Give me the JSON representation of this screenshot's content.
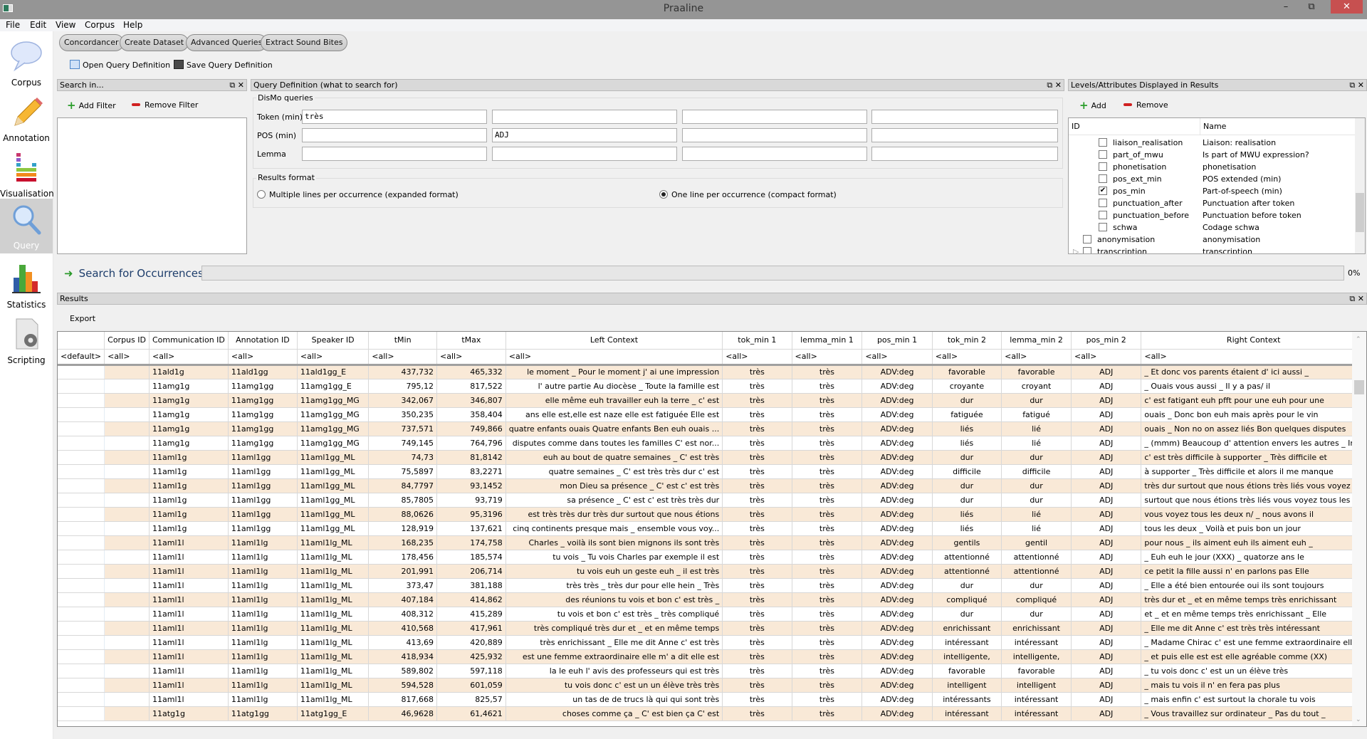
{
  "window": {
    "title": "Praaline"
  },
  "menu": [
    "File",
    "Edit",
    "View",
    "Corpus",
    "Help"
  ],
  "sidebar": {
    "items": [
      {
        "label": "Corpus",
        "icon": "speech-bubble-icon",
        "active": false
      },
      {
        "label": "Annotation",
        "icon": "pencil-icon",
        "active": false
      },
      {
        "label": "Visualisation",
        "icon": "equalizer-icon",
        "active": false
      },
      {
        "label": "Query",
        "icon": "magnifier-icon",
        "active": true
      },
      {
        "label": "Statistics",
        "icon": "bar-chart-icon",
        "active": false
      },
      {
        "label": "Scripting",
        "icon": "script-gear-icon",
        "active": false
      }
    ]
  },
  "modules": [
    "Concordancer",
    "Create Dataset",
    "Advanced Queries",
    "Extract Sound Bites"
  ],
  "toolbar": {
    "open_label": "Open Query Definition",
    "save_label": "Save Query Definition"
  },
  "search_in": {
    "title": "Search in...",
    "add_label": "Add Filter",
    "remove_label": "Remove Filter"
  },
  "query_def": {
    "title": "Query Definition (what to search for)",
    "group_label": "DisMo queries",
    "rows": [
      {
        "label": "Token (min)",
        "values": [
          "très",
          "",
          "",
          ""
        ]
      },
      {
        "label": "POS (min)",
        "values": [
          "",
          "ADJ",
          "",
          ""
        ]
      },
      {
        "label": "Lemma",
        "values": [
          "",
          "",
          "",
          ""
        ]
      }
    ],
    "results_format": {
      "label": "Results format",
      "options": [
        {
          "label": "Multiple lines per occurrence (expanded format)",
          "selected": false
        },
        {
          "label": "One line per occurrence (compact format)",
          "selected": true
        }
      ]
    }
  },
  "levels": {
    "title": "Levels/Attributes Displayed in Results",
    "add_label": "Add",
    "remove_label": "Remove",
    "columns": [
      "ID",
      "Name"
    ],
    "items": [
      {
        "id": "liaison_realisation",
        "name": "Liaison: realisation",
        "checked": false,
        "indent": 2
      },
      {
        "id": "part_of_mwu",
        "name": "Is part of MWU expression?",
        "checked": false,
        "indent": 2
      },
      {
        "id": "phonetisation",
        "name": "phonetisation",
        "checked": false,
        "indent": 2
      },
      {
        "id": "pos_ext_min",
        "name": "POS extended (min)",
        "checked": false,
        "indent": 2
      },
      {
        "id": "pos_min",
        "name": "Part-of-speech (min)",
        "checked": true,
        "indent": 2
      },
      {
        "id": "punctuation_after",
        "name": "Punctuation after token",
        "checked": false,
        "indent": 2
      },
      {
        "id": "punctuation_before",
        "name": "Punctuation before token",
        "checked": false,
        "indent": 2
      },
      {
        "id": "schwa",
        "name": "Codage schwa",
        "checked": false,
        "indent": 2
      },
      {
        "id": "anonymisation",
        "name": "anonymisation",
        "checked": false,
        "indent": 1
      },
      {
        "id": "transcription",
        "name": "transcription",
        "checked": false,
        "indent": 1,
        "expandable": true
      }
    ]
  },
  "search": {
    "button_label": "Search for Occurrences",
    "progress_percent": 0,
    "progress_label": "0%"
  },
  "results": {
    "title": "Results",
    "export_label": "Export",
    "columns": [
      "",
      "Corpus ID",
      "Communication ID",
      "Annotation ID",
      "Speaker ID",
      "tMin",
      "tMax",
      "Left Context",
      "tok_min 1",
      "lemma_min 1",
      "pos_min 1",
      "tok_min 2",
      "lemma_min 2",
      "pos_min 2",
      "Right Context"
    ],
    "filters": [
      "<default>",
      "<all>",
      "<all>",
      "<all>",
      "<all>",
      "<all>",
      "<all>",
      "<all>",
      "<all>",
      "<all>",
      "<all>",
      "<all>",
      "<all>",
      "<all>",
      "<all>"
    ],
    "rows": [
      [
        "",
        "",
        "11ald1g",
        "11ald1gg",
        "11ald1gg_E",
        "437,732",
        "465,332",
        "le moment _ Pour le moment j' ai une impression",
        "très",
        "très",
        "ADV:deg",
        "favorable",
        "favorable",
        "ADJ",
        "_ Et donc vos parents étaient d' ici aussi _"
      ],
      [
        "",
        "",
        "11amg1g",
        "11amg1gg",
        "11amg1gg_E",
        "795,12",
        "817,522",
        "l' autre partie Au diocèse _ Toute la famille est",
        "très",
        "très",
        "ADV:deg",
        "croyante",
        "croyant",
        "ADJ",
        "_ Ouais vous aussi _ Il y a pas/ il"
      ],
      [
        "",
        "",
        "11amg1g",
        "11amg1gg",
        "11amg1gg_MG",
        "342,067",
        "346,807",
        "elle même euh travailler euh la terre _ c' est",
        "très",
        "très",
        "ADV:deg",
        "dur",
        "dur",
        "ADJ",
        "c' est fatigant euh pfft pour une euh pour une"
      ],
      [
        "",
        "",
        "11amg1g",
        "11amg1gg",
        "11amg1gg_MG",
        "350,235",
        "358,404",
        "ans elle est,elle est naze elle est fatiguée Elle est",
        "très",
        "très",
        "ADV:deg",
        "fatiguée",
        "fatigué",
        "ADJ",
        "ouais _ Donc bon euh mais après pour le vin"
      ],
      [
        "",
        "",
        "11amg1g",
        "11amg1gg",
        "11amg1gg_MG",
        "737,571",
        "749,866",
        "quatre enfants ouais Quatre enfants Ben euh ouais ...",
        "très",
        "très",
        "ADV:deg",
        "liés",
        "lié",
        "ADJ",
        "ouais _ Non no on assez liés Bon quelques disputes"
      ],
      [
        "",
        "",
        "11amg1g",
        "11amg1gg",
        "11amg1gg_MG",
        "749,145",
        "764,796",
        "disputes comme dans toutes les familles C' est nor...",
        "très",
        "très",
        "ADV:deg",
        "liés",
        "lié",
        "ADJ",
        "_ (mmm) Beaucoup d' attention envers les autres _ In..."
      ],
      [
        "",
        "",
        "11aml1g",
        "11aml1gg",
        "11aml1gg_ML",
        "74,73",
        "81,8142",
        "euh au bout de quatre semaines _ C' est très",
        "très",
        "très",
        "ADV:deg",
        "dur",
        "dur",
        "ADJ",
        "c' est très difficile à supporter _ Très difficile et"
      ],
      [
        "",
        "",
        "11aml1g",
        "11aml1gg",
        "11aml1gg_ML",
        "75,5897",
        "83,2271",
        "quatre semaines _ C' est très très dur c' est",
        "très",
        "très",
        "ADV:deg",
        "difficile",
        "difficile",
        "ADJ",
        "à supporter _ Très difficile et alors il me manque"
      ],
      [
        "",
        "",
        "11aml1g",
        "11aml1gg",
        "11aml1gg_ML",
        "84,7797",
        "93,1452",
        "mon Dieu sa présence _ C' est c' est très",
        "très",
        "très",
        "ADV:deg",
        "dur",
        "dur",
        "ADJ",
        "très dur surtout que nous étions très liés vous voyez"
      ],
      [
        "",
        "",
        "11aml1g",
        "11aml1gg",
        "11aml1gg_ML",
        "85,7805",
        "93,719",
        "sa présence _ C' est c' est très très dur",
        "très",
        "très",
        "ADV:deg",
        "dur",
        "dur",
        "ADJ",
        "surtout que nous étions très liés vous voyez tous les"
      ],
      [
        "",
        "",
        "11aml1g",
        "11aml1gg",
        "11aml1gg_ML",
        "88,0626",
        "95,3196",
        "est très très dur très dur surtout que nous étions",
        "très",
        "très",
        "ADV:deg",
        "liés",
        "lié",
        "ADJ",
        "vous voyez tous les deux n/ _ nous avons il"
      ],
      [
        "",
        "",
        "11aml1g",
        "11aml1gg",
        "11aml1gg_ML",
        "128,919",
        "137,621",
        "cinq continents presque mais _ ensemble vous voy...",
        "très",
        "très",
        "ADV:deg",
        "liés",
        "lié",
        "ADJ",
        "tous les deux _ Voilà et puis bon un jour"
      ],
      [
        "",
        "",
        "11aml1l",
        "11aml1lg",
        "11aml1lg_ML",
        "168,235",
        "174,758",
        "Charles _ voilà ils sont bien mignons ils sont très",
        "très",
        "très",
        "ADV:deg",
        "gentils",
        "gentil",
        "ADJ",
        "pour nous _ ils aiment euh ils aiment euh _"
      ],
      [
        "",
        "",
        "11aml1l",
        "11aml1lg",
        "11aml1lg_ML",
        "178,456",
        "185,574",
        "tu vois _ Tu vois Charles par exemple il est",
        "très",
        "très",
        "ADV:deg",
        "attentionné",
        "attentionné",
        "ADJ",
        "_ Euh euh le jour (XXX) _ quatorze ans le"
      ],
      [
        "",
        "",
        "11aml1l",
        "11aml1lg",
        "11aml1lg_ML",
        "201,991",
        "206,714",
        "tu vois euh un geste euh _ il est très",
        "très",
        "très",
        "ADV:deg",
        "attentionné",
        "attentionné",
        "ADJ",
        "ce petit la fille aussi n' en parlons pas Elle"
      ],
      [
        "",
        "",
        "11aml1l",
        "11aml1lg",
        "11aml1lg_ML",
        "373,47",
        "381,188",
        "très très _ très dur pour elle hein _ Très",
        "très",
        "très",
        "ADV:deg",
        "dur",
        "dur",
        "ADJ",
        "_ Elle a été bien entourée oui ils sont toujours"
      ],
      [
        "",
        "",
        "11aml1l",
        "11aml1lg",
        "11aml1lg_ML",
        "407,184",
        "414,862",
        "des réunions tu vois et bon c' est très _",
        "très",
        "très",
        "ADV:deg",
        "compliqué",
        "compliqué",
        "ADJ",
        "très dur et _ et en même temps très enrichissant"
      ],
      [
        "",
        "",
        "11aml1l",
        "11aml1lg",
        "11aml1lg_ML",
        "408,312",
        "415,289",
        "tu vois et bon c' est très _ très compliqué",
        "très",
        "très",
        "ADV:deg",
        "dur",
        "dur",
        "ADJ",
        "et _ et en même temps très enrichissant _ Elle"
      ],
      [
        "",
        "",
        "11aml1l",
        "11aml1lg",
        "11aml1lg_ML",
        "410,568",
        "417,961",
        "très compliqué très dur et _ et en même temps",
        "très",
        "très",
        "ADV:deg",
        "enrichissant",
        "enrichissant",
        "ADJ",
        "_ Elle me dit Anne c' est très très intéressant"
      ],
      [
        "",
        "",
        "11aml1l",
        "11aml1lg",
        "11aml1lg_ML",
        "413,69",
        "420,889",
        "très enrichissant _ Elle me dit Anne c' est très",
        "très",
        "très",
        "ADV:deg",
        "intéressant",
        "intéressant",
        "ADJ",
        "_ Madame Chirac c' est une femme extraordinaire ell..."
      ],
      [
        "",
        "",
        "11aml1l",
        "11aml1lg",
        "11aml1lg_ML",
        "418,934",
        "425,932",
        "est une femme extraordinaire elle m' a dit elle est",
        "très",
        "très",
        "ADV:deg",
        "intelligente,",
        "intelligente,",
        "ADJ",
        "_ et puis elle est est elle agréable comme (XX)"
      ],
      [
        "",
        "",
        "11aml1l",
        "11aml1lg",
        "11aml1lg_ML",
        "589,802",
        "597,118",
        "la le euh l' avis des professeurs qui est très",
        "très",
        "très",
        "ADV:deg",
        "favorable",
        "favorable",
        "ADJ",
        "_ tu vois donc c' est un un élève très"
      ],
      [
        "",
        "",
        "11aml1l",
        "11aml1lg",
        "11aml1lg_ML",
        "594,528",
        "601,059",
        "tu vois donc c' est un un élève très très",
        "très",
        "très",
        "ADV:deg",
        "intelligent",
        "intelligent",
        "ADJ",
        "_ mais tu vois il n' en fera pas plus"
      ],
      [
        "",
        "",
        "11aml1l",
        "11aml1lg",
        "11aml1lg_ML",
        "817,668",
        "825,57",
        "un tas de de trucs là qui qui sont très",
        "très",
        "très",
        "ADV:deg",
        "intéressants",
        "intéressant",
        "ADJ",
        "_ mais enfin c' est surtout la chorale tu vois"
      ],
      [
        "",
        "",
        "11atg1g",
        "11atg1gg",
        "11atg1gg_E",
        "46,9628",
        "61,4621",
        "choses comme ça _ C' est bien ça C' est",
        "très",
        "très",
        "ADV:deg",
        "intéressant",
        "intéressant",
        "ADJ",
        "_ Vous travaillez sur ordinateur _ Pas du tout _"
      ]
    ]
  },
  "colors": {
    "row_highlight": "#f9e9d7",
    "title_bar": "#959595",
    "close_button": "#c75050"
  }
}
